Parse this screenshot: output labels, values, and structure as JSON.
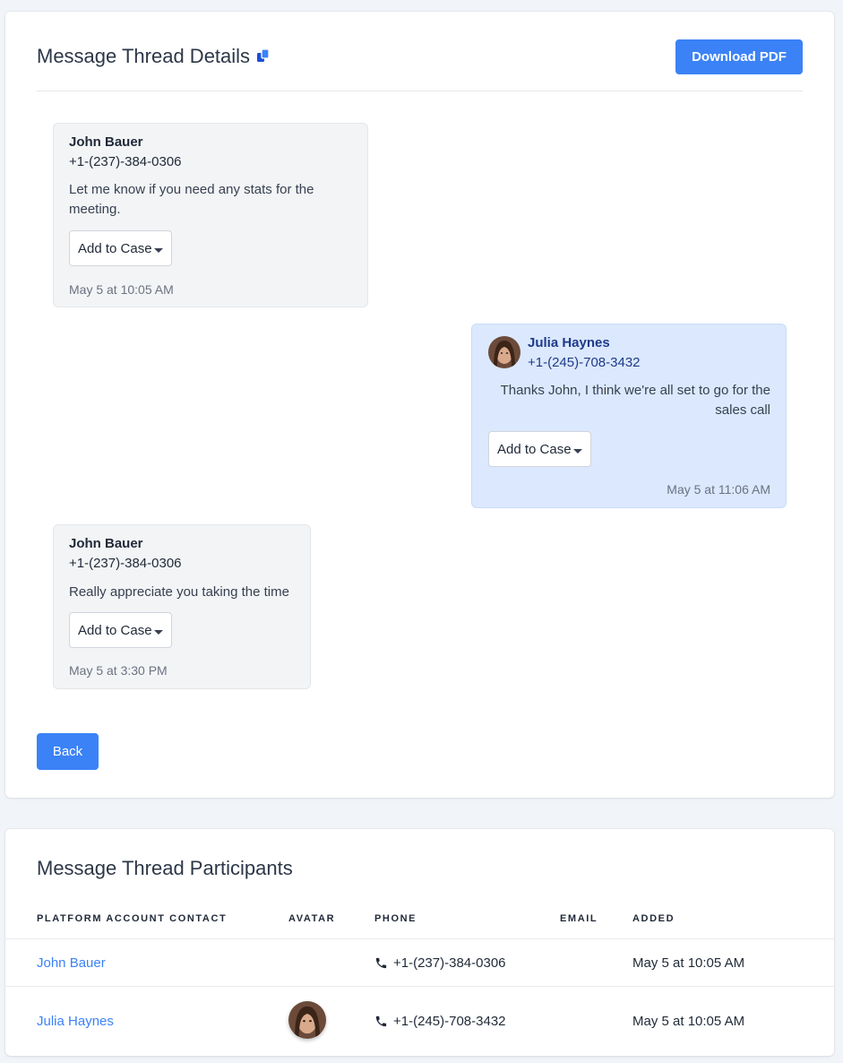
{
  "details": {
    "title": "Message Thread Details",
    "download_label": "Download PDF",
    "back_label": "Back"
  },
  "messages": [
    {
      "sender": "John Bauer",
      "phone": "+1-(237)-384-0306",
      "text": "Let me know if you need any stats for the meeting.",
      "action_label": "Add to Case",
      "time": "May 5 at 10:05 AM",
      "direction": "incoming"
    },
    {
      "sender": "Julia Haynes",
      "phone": "+1-(245)-708-3432",
      "text": "Thanks John, I think we're all set to go for the sales call",
      "action_label": "Add to Case",
      "time": "May 5 at 11:06 AM",
      "direction": "outgoing"
    },
    {
      "sender": "John Bauer",
      "phone": "+1-(237)-384-0306",
      "text": "Really appreciate you taking the time",
      "action_label": "Add to Case",
      "time": "May 5 at 3:30 PM",
      "direction": "incoming"
    }
  ],
  "participants": {
    "title": "Message Thread Participants",
    "columns": [
      "PLATFORM ACCOUNT CONTACT",
      "AVATAR",
      "PHONE",
      "EMAIL",
      "ADDED"
    ],
    "rows": [
      {
        "contact": "John Bauer",
        "has_avatar": false,
        "phone": "+1-(237)-384-0306",
        "email": "",
        "added": "May 5 at 10:05 AM"
      },
      {
        "contact": "Julia Haynes",
        "has_avatar": true,
        "phone": "+1-(245)-708-3432",
        "email": "",
        "added": "May 5 at 10:05 AM"
      }
    ]
  },
  "colors": {
    "primary": "#3b82f6",
    "outgoing_bubble": "#dbe8fd",
    "incoming_bubble": "#f3f4f6",
    "link": "#3b82f6"
  },
  "icons": {
    "copy": "copy-icon",
    "caret": "caret-down-icon",
    "phone": "phone-icon"
  }
}
